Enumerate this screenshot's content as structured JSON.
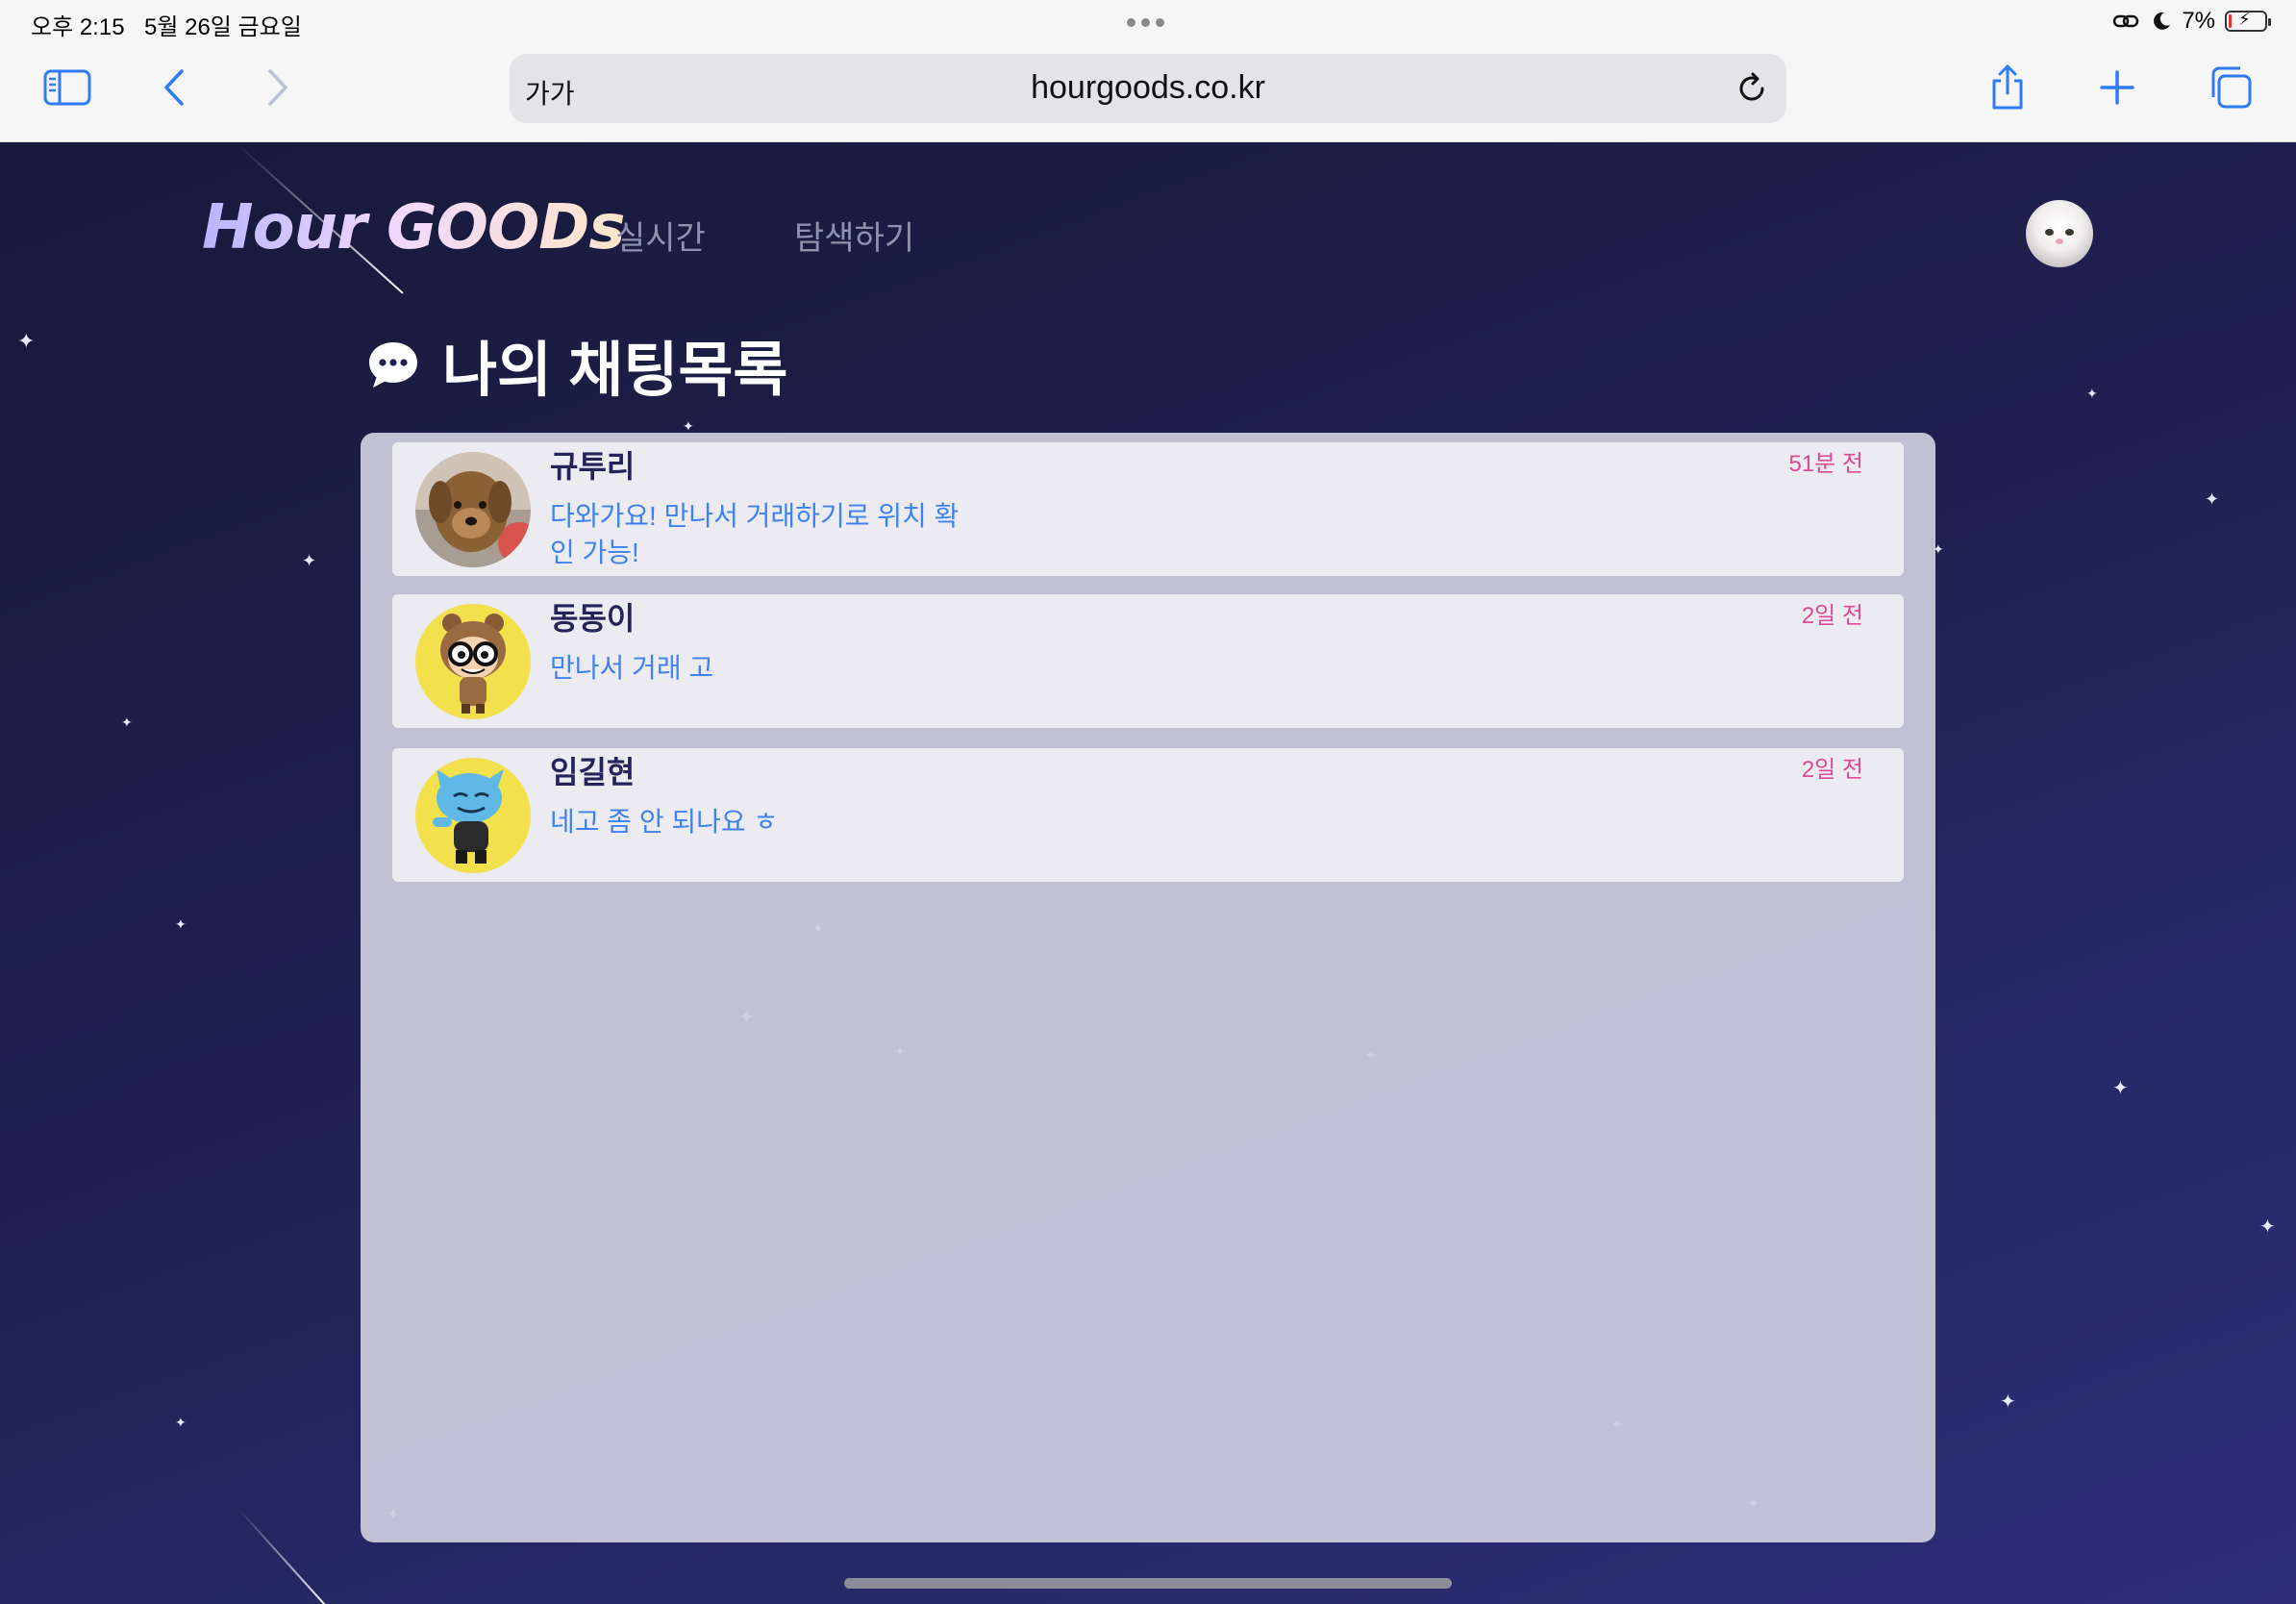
{
  "status_bar": {
    "time": "오후 2:15",
    "date": "5월 26일 금요일",
    "battery": "7%",
    "battery_level": 0.07
  },
  "toolbar": {
    "text_size_label": "가가",
    "url": "hourgoods.co.kr",
    "icons": [
      "sidebar-icon",
      "back-icon",
      "forward-icon",
      "reload-icon",
      "share-icon",
      "new-tab-icon",
      "tabs-icon"
    ]
  },
  "site": {
    "logo": "Hour GOODs",
    "nav": [
      "실시간",
      "탐색하기"
    ]
  },
  "page_title": "나의 채팅목록",
  "chats": [
    {
      "name": "규투리",
      "message": "다와가요! 만나서 거래하기로 위치 확인 가능!",
      "time": "51분 전",
      "avatar": "dog-photo"
    },
    {
      "name": "동동이",
      "message": "만나서 거래 고",
      "time": "2일 전",
      "avatar": "cartoon-bear-costume"
    },
    {
      "name": "임길현",
      "message": "네고 좀 안 되나요 ㅎ",
      "time": "2일 전",
      "avatar": "cartoon-blue-cat"
    }
  ],
  "colors": {
    "accent": "#2f7bf5",
    "chat_name": "#23245a",
    "chat_message": "#3f82ef",
    "chat_time": "#df4a96",
    "page_bg": "#1f2050"
  }
}
